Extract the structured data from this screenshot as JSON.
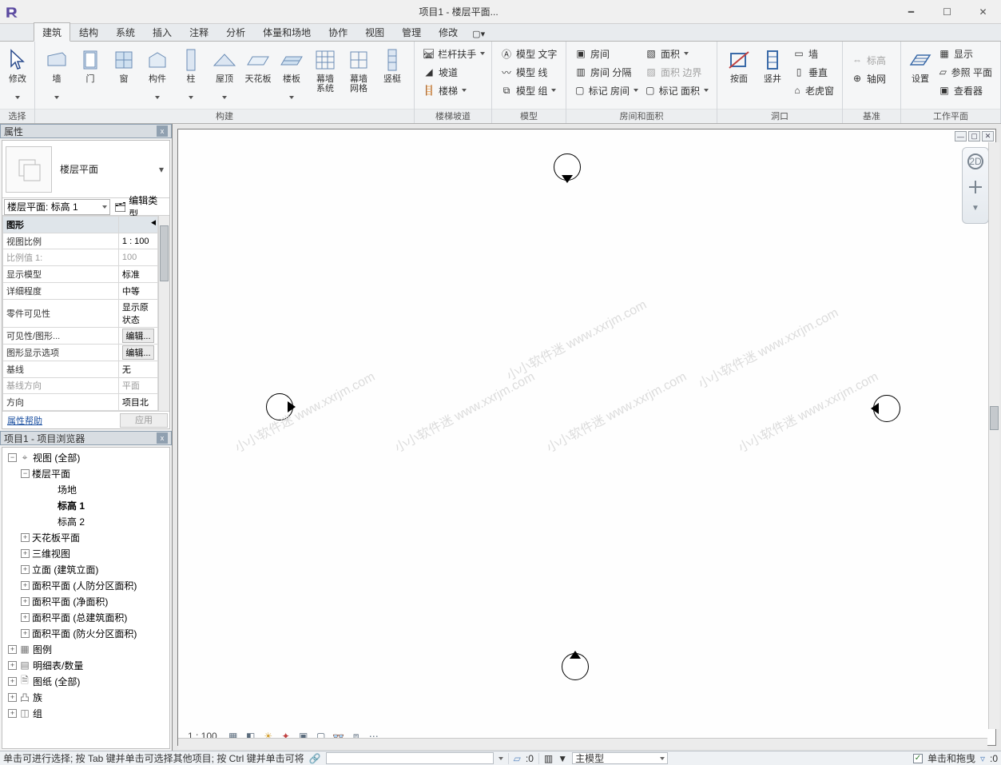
{
  "title": "项目1 - 楼层平面...",
  "tabs": [
    "建筑",
    "结构",
    "系统",
    "插入",
    "注释",
    "分析",
    "体量和场地",
    "协作",
    "视图",
    "管理",
    "修改"
  ],
  "activeTab": 0,
  "ribbon": {
    "select": {
      "modify": "修改",
      "group": "选择"
    },
    "build": {
      "group": "构建",
      "items": [
        "墙",
        "门",
        "窗",
        "构件",
        "柱",
        "屋顶",
        "天花板",
        "楼板",
        "幕墙\n系统",
        "幕墙\n网格",
        "竖梃"
      ]
    },
    "stairramp": {
      "group": "楼梯坡道",
      "rail": "栏杆扶手",
      "ramp": "坡道",
      "stair": "楼梯"
    },
    "model": {
      "group": "模型",
      "text": "模型 文字",
      "line": "模型 线",
      "grp": "模型 组"
    },
    "room": {
      "group": "房间和面积",
      "room": "房间",
      "sep": "房间 分隔",
      "tag": "标记 房间",
      "area": "面积",
      "abnd": "面积 边界",
      "atag": "标记 面积"
    },
    "opening": {
      "group": "洞口",
      "face": "按面",
      "shaft": "竖井",
      "wall": "墙",
      "vert": "垂直",
      "dormer": "老虎窗"
    },
    "datum": {
      "group": "基准",
      "level": "标高",
      "grid": "轴网"
    },
    "workplane": {
      "group": "工作平面",
      "set": "设置",
      "show": "显示",
      "ref": "参照 平面",
      "viewer": "查看器"
    }
  },
  "propsPanel": {
    "head": "属性",
    "typeName": "楼层平面",
    "selector": "楼层平面: 标高 1",
    "editType": "编辑类型",
    "groupGraphics": "图形",
    "rows": [
      {
        "k": "视图比例",
        "v": "1 : 100"
      },
      {
        "k": "比例值 1:",
        "v": "100",
        "dim": true
      },
      {
        "k": "显示模型",
        "v": "标准"
      },
      {
        "k": "详细程度",
        "v": "中等"
      },
      {
        "k": "零件可见性",
        "v": "显示原状态"
      },
      {
        "k": "可见性/图形...",
        "v": "编辑...",
        "btn": true
      },
      {
        "k": "图形显示选项",
        "v": "编辑...",
        "btn": true
      },
      {
        "k": "基线",
        "v": "无"
      },
      {
        "k": "基线方向",
        "v": "平面",
        "dim": true
      },
      {
        "k": "方向",
        "v": "项目北"
      }
    ],
    "help": "属性帮助",
    "apply": "应用"
  },
  "browser": {
    "head": "项目1 - 项目浏览器",
    "root": "视图 (全部)",
    "floorPlans": "楼层平面",
    "fp": [
      "场地",
      "标高 1",
      "标高 2"
    ],
    "fpActive": "标高 1",
    "nodes": [
      "天花板平面",
      "三维视图",
      "立面 (建筑立面)",
      "面积平面 (人防分区面积)",
      "面积平面 (净面积)",
      "面积平面 (总建筑面积)",
      "面积平面 (防火分区面积)"
    ],
    "leaf": [
      "图例",
      "明细表/数量",
      "图纸 (全部)",
      "族",
      "组"
    ]
  },
  "viewbarScale": "1 : 100",
  "status": {
    "hint": "单击可进行选择; 按 Tab 键并单击可选择其他项目; 按 Ctrl 键并单击可将",
    "zero": ":0",
    "model": "主模型",
    "drag": "单击和拖曳",
    "zero2": ":0"
  },
  "watermark": "小小软件迷 www.xxrjm.com"
}
